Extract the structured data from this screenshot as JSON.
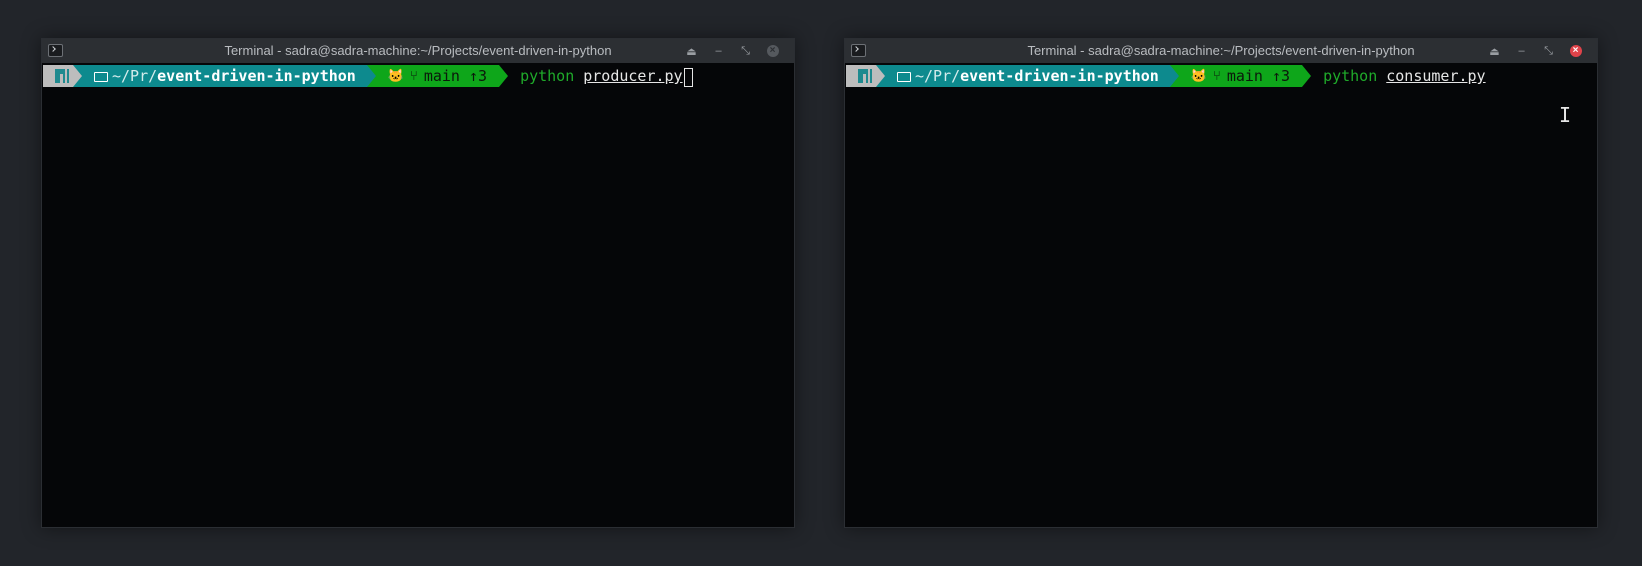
{
  "windows": [
    {
      "title": "Terminal - sadra@sadra-machine:~/Projects/event-driven-in-python",
      "prompt": {
        "dir_prefix": "~/Pr/",
        "dir_name": "event-driven-in-python",
        "branch": "main",
        "ahead": "↑3"
      },
      "command": "python",
      "argument": "producer.py"
    },
    {
      "title": "Terminal - sadra@sadra-machine:~/Projects/event-driven-in-python",
      "prompt": {
        "dir_prefix": "~/Pr/",
        "dir_name": "event-driven-in-python",
        "branch": "main",
        "ahead": "↑3"
      },
      "command": "python",
      "argument": "consumer.py"
    }
  ],
  "icons": {
    "app": "terminal-icon",
    "shade": "shade-icon",
    "minimize": "minimize-icon",
    "maximize": "maximize-icon",
    "close": "close-icon",
    "folder": "folder-open-icon",
    "git": "github-cat-icon",
    "branch": "git-branch-icon",
    "os": "manjaro-logo-icon",
    "mouse": "ibeam-cursor-icon"
  },
  "colors": {
    "desktop": "#22252a",
    "titlebar": "#2c2f33",
    "terminal_bg": "#050608",
    "segment_os": "#bdbdbd",
    "segment_dir": "#0d8a8e",
    "segment_git": "#0ea61a",
    "command": "#1faa2a",
    "close_active": "#e0434a"
  }
}
